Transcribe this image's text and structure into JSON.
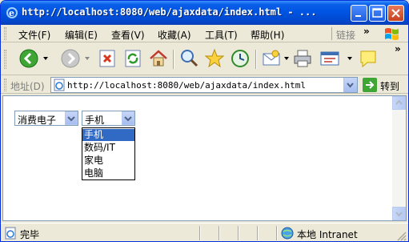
{
  "window": {
    "title": "http://localhost:8080/web/ajaxdata/index.html - ..."
  },
  "menu": {
    "items": [
      "文件(F)",
      "编辑(E)",
      "查看(V)",
      "收藏(A)",
      "工具(T)",
      "帮助(H)"
    ],
    "links_label": "链接",
    "chevron": "»"
  },
  "toolbar": {
    "icons": [
      "back-icon",
      "forward-icon",
      "stop-icon",
      "refresh-icon",
      "home-icon",
      "search-icon",
      "favorites-icon",
      "history-icon",
      "mail-icon",
      "print-icon",
      "edit-icon",
      "messenger-icon"
    ]
  },
  "address": {
    "label": "地址(D)",
    "url": "http://localhost:8080/web/ajaxdata/index.html",
    "go_label": "转到"
  },
  "page": {
    "category_select": {
      "value": "消费电子"
    },
    "product_select": {
      "value": "手机",
      "options": [
        "手机",
        "数码/IT",
        "家电",
        "电脑"
      ],
      "highlighted_index": 0
    }
  },
  "status": {
    "text": "完毕",
    "zone": "本地 Intranet"
  },
  "colors": {
    "title_blue": "#0054e3",
    "highlight": "#316ac5",
    "chrome": "#ece9d8"
  }
}
